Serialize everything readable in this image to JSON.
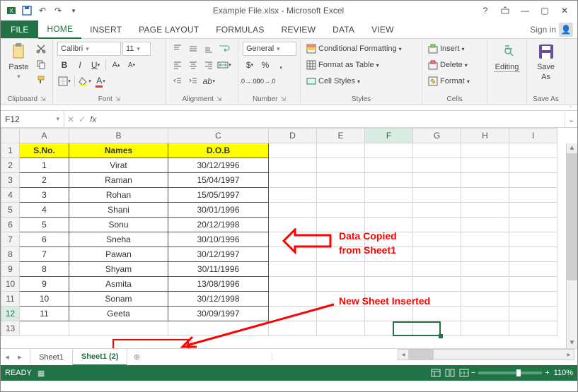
{
  "window": {
    "title": "Example File.xlsx - Microsoft Excel",
    "signin": "Sign in"
  },
  "tabs": {
    "file": "FILE",
    "items": [
      "HOME",
      "INSERT",
      "PAGE LAYOUT",
      "FORMULAS",
      "REVIEW",
      "DATA",
      "VIEW"
    ],
    "active": "HOME"
  },
  "ribbon": {
    "clipboard": {
      "label": "Clipboard",
      "paste": "Paste"
    },
    "font": {
      "label": "Font",
      "name": "Calibri",
      "size": "11"
    },
    "alignment": {
      "label": "Alignment"
    },
    "number": {
      "label": "Number",
      "format": "General"
    },
    "styles": {
      "label": "Styles",
      "cond": "Conditional Formatting",
      "table": "Format as Table",
      "cell": "Cell Styles"
    },
    "cells": {
      "label": "Cells",
      "insert": "Insert",
      "delete": "Delete",
      "format": "Format"
    },
    "editing": {
      "label": "Editing"
    },
    "saveas": {
      "label": "Save As",
      "btn1": "Save",
      "btn2": "As"
    }
  },
  "formula_bar": {
    "namebox": "F12",
    "fx": "fx",
    "value": ""
  },
  "columns": [
    "A",
    "B",
    "C",
    "D",
    "E",
    "F",
    "G",
    "H",
    "I"
  ],
  "rows": [
    "1",
    "2",
    "3",
    "4",
    "5",
    "6",
    "7",
    "8",
    "9",
    "10",
    "11",
    "12",
    "13"
  ],
  "headers": {
    "a": "S.No.",
    "b": "Names",
    "c": "D.O.B"
  },
  "data": [
    {
      "n": "1",
      "name": "Virat",
      "dob": "30/12/1996"
    },
    {
      "n": "2",
      "name": "Raman",
      "dob": "15/04/1997"
    },
    {
      "n": "3",
      "name": "Rohan",
      "dob": "15/05/1997"
    },
    {
      "n": "4",
      "name": "Shani",
      "dob": "30/01/1996"
    },
    {
      "n": "5",
      "name": "Sonu",
      "dob": "20/12/1998"
    },
    {
      "n": "6",
      "name": "Sneha",
      "dob": "30/10/1996"
    },
    {
      "n": "7",
      "name": "Pawan",
      "dob": "30/12/1997"
    },
    {
      "n": "8",
      "name": "Shyam",
      "dob": "30/11/1996"
    },
    {
      "n": "9",
      "name": "Asmita",
      "dob": "13/08/1996"
    },
    {
      "n": "10",
      "name": "Sonam",
      "dob": "30/12/1998"
    },
    {
      "n": "11",
      "name": "Geeta",
      "dob": "30/09/1997"
    }
  ],
  "sheets": {
    "tab1": "Sheet1",
    "tab2": "Sheet1 (2)"
  },
  "annotations": {
    "copied1": "Data Copied",
    "copied2": "from Sheet1",
    "newsheet": "New Sheet Inserted"
  },
  "status": {
    "ready": "READY",
    "zoom": "110%"
  },
  "selected_cell": "F12"
}
